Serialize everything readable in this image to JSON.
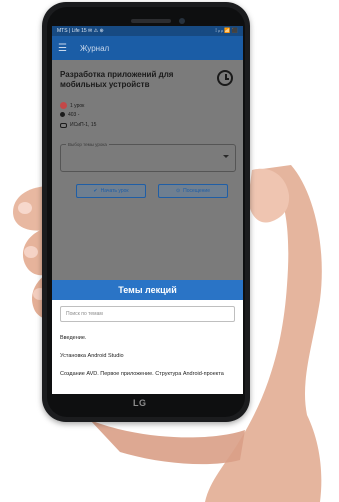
{
  "status": {
    "left": "MTS | Life 15 ✉ ⚠ ⊕",
    "right": "⁞ ᵢₗ ᵢₗ 📶 ⬛"
  },
  "appbar": {
    "menu_icon": "hamburger-icon",
    "title": "Журнал"
  },
  "course": {
    "title": "Разработка приложений для мобильных устройств",
    "meta": [
      {
        "icon": "badge",
        "text": "1 урок"
      },
      {
        "icon": "location-pin-icon",
        "text": "403 -"
      },
      {
        "icon": "group-icon",
        "text": "ИСиП-1, 15"
      }
    ]
  },
  "select": {
    "label": "Выбор темы урока"
  },
  "buttons": {
    "start": "Начать урок",
    "attendance": "Посещение"
  },
  "sheet": {
    "header": "Темы лекций",
    "search_placeholder": "Поиск по темам",
    "topics": [
      "Введение.",
      "Установка Android Studio",
      "Создание AVD. Первое приложение. Структура Android-проекта"
    ]
  },
  "device_logo": "LG"
}
